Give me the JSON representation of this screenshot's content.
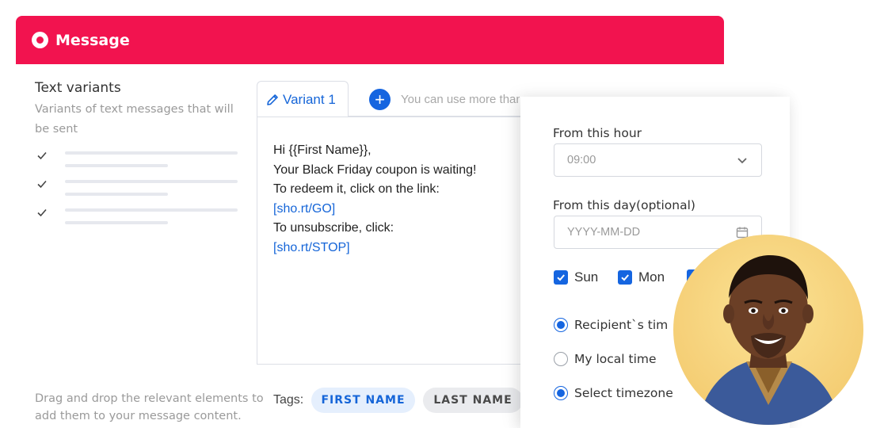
{
  "header": {
    "title": "Message",
    "color": "#f2134f"
  },
  "left": {
    "title": "Text variants",
    "subtitle": "Variants of text messages that will be sent",
    "drag_hint": "Drag and drop the relevant elements to add them to your message content."
  },
  "tabs": {
    "active_label": "Variant 1",
    "add_hint": "You can use more than one text for A/B testing"
  },
  "editor": {
    "lines": [
      "Hi {{First Name}},",
      "Your Black Friday coupon is waiting!",
      "To redeem it, click on the link:",
      "[sho.rt/GO]",
      "To unsubscribe, click:",
      "[sho.rt/STOP]"
    ]
  },
  "tags": {
    "label": "Tags:",
    "items": [
      "FIRST NAME",
      "LAST NAME"
    ]
  },
  "schedule": {
    "hour_label": "From this hour",
    "hour_value": "09:00",
    "day_label": "From this day(optional)",
    "day_placeholder": "YYYY-MM-DD",
    "days": [
      {
        "label": "Sun",
        "checked": true
      },
      {
        "label": "Mon",
        "checked": true
      }
    ],
    "timezone_options": [
      {
        "label": "Recipient`s tim",
        "selected": true
      },
      {
        "label": "My local time",
        "selected": false
      },
      {
        "label": "Select timezone",
        "selected": true
      }
    ]
  },
  "accent_color": "#1565e0"
}
